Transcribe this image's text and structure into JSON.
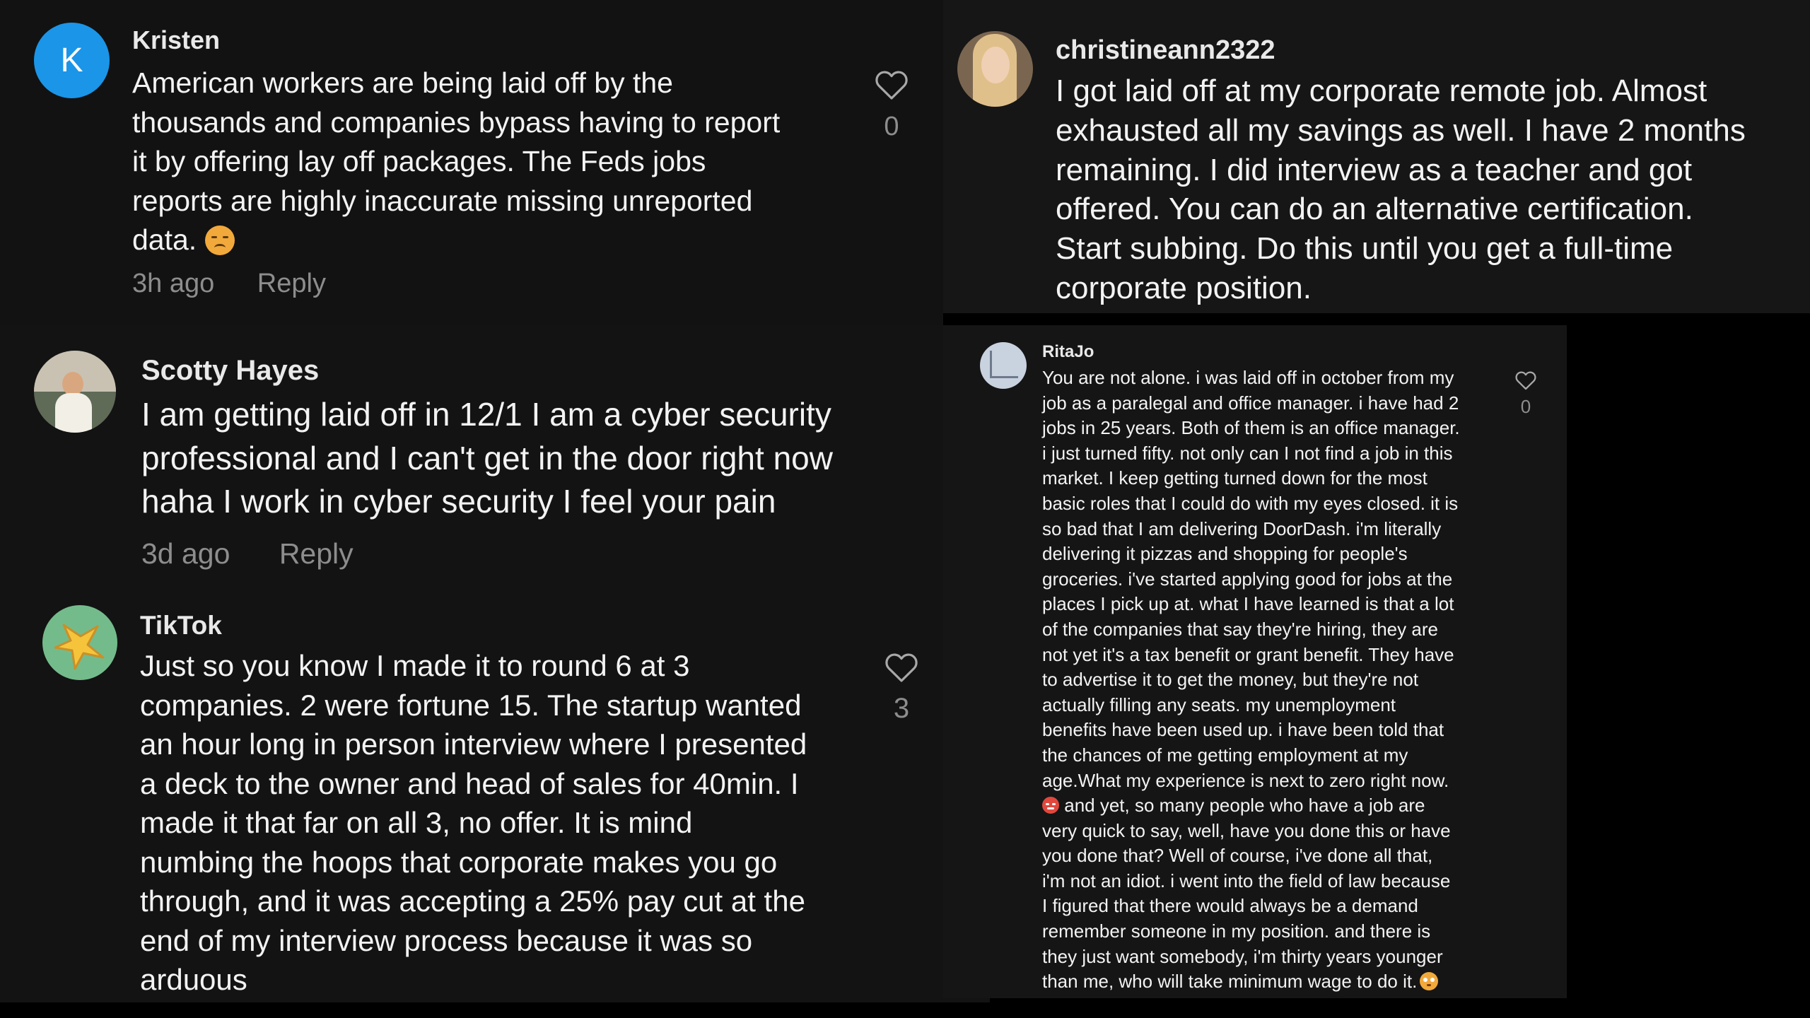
{
  "comments": [
    {
      "username": "Kristen",
      "avatar_letter": "K",
      "lines": [
        "American workers are being laid off by the",
        "thousands and companies bypass having to report",
        "it by offering lay off packages. The Feds jobs",
        "reports are highly inaccurate missing unreported",
        "data."
      ],
      "time": "3h ago",
      "reply_label": "Reply",
      "likes": "0"
    },
    {
      "username": "christineann2322",
      "lines": [
        "I got laid off at my corporate remote job. Almost",
        "exhausted all my savings as well. I have 2 months",
        "remaining. I did interview as a teacher and got",
        "offered. You can do an alternative certification.",
        "Start subbing. Do this until you get a full-time",
        "corporate position."
      ]
    },
    {
      "username": "Scotty Hayes",
      "lines": [
        "I am getting laid off in 12/1 I am a cyber security",
        "professional and I can't get in the door right now",
        "haha I work in cyber security I feel your pain"
      ],
      "time": "3d ago",
      "reply_label": "Reply"
    },
    {
      "username": "TikTok",
      "lines": [
        "Just so you know I made it to round 6 at 3",
        "companies. 2 were fortune 15. The startup wanted",
        "an hour long in person interview where I presented",
        "a deck to the owner and head of sales for 40min. I",
        "made it that far on all 3, no offer. It is mind",
        "numbing the hoops that corporate makes you go",
        "through, and it was accepting a 25% pay cut at the",
        "end of my interview process because it was so",
        "arduous"
      ],
      "likes": "3"
    },
    {
      "username": "RitaJo",
      "lines": [
        "You are not alone. i was laid off in october from my",
        "job as a paralegal and office manager. i have had 2",
        "jobs in 25 years. Both of them is an office manager.",
        "i just turned fifty. not only can I not find a job in this",
        "market. I keep getting turned down for the most",
        "basic roles that I could do with my eyes closed. it is",
        "so bad that I am delivering DoorDash. i'm literally",
        "delivering it pizzas and shopping for people's",
        "groceries. i've started applying good for jobs at the",
        "places I pick up at. what I have learned is that a lot",
        "of the companies that say they're hiring, they are",
        "not yet it's a tax benefit or grant benefit. They have",
        "to advertise it to get the money, but they're not",
        "actually filling any seats. my unemployment",
        "benefits have been used up. i have been told that",
        "the chances of me getting employment at my",
        "age.What my experience is next to zero right now.",
        "and yet, so many people who have a job are",
        "very quick to say, well, have you done this or have",
        "you done that? Well of course, i've done all that,",
        "i'm not an idiot. i went into the field of law because",
        "I figured that there would always be a demand",
        "remember someone in my position. and there is",
        "they just want somebody, i'm thirty years younger",
        "than me, who will take minimum wage to do it."
      ],
      "likes": "0"
    }
  ],
  "colors": {
    "avatar_k": "#1b95e8",
    "muted_text": "#8d8d8d",
    "emoji_face": "#f2a93b"
  }
}
